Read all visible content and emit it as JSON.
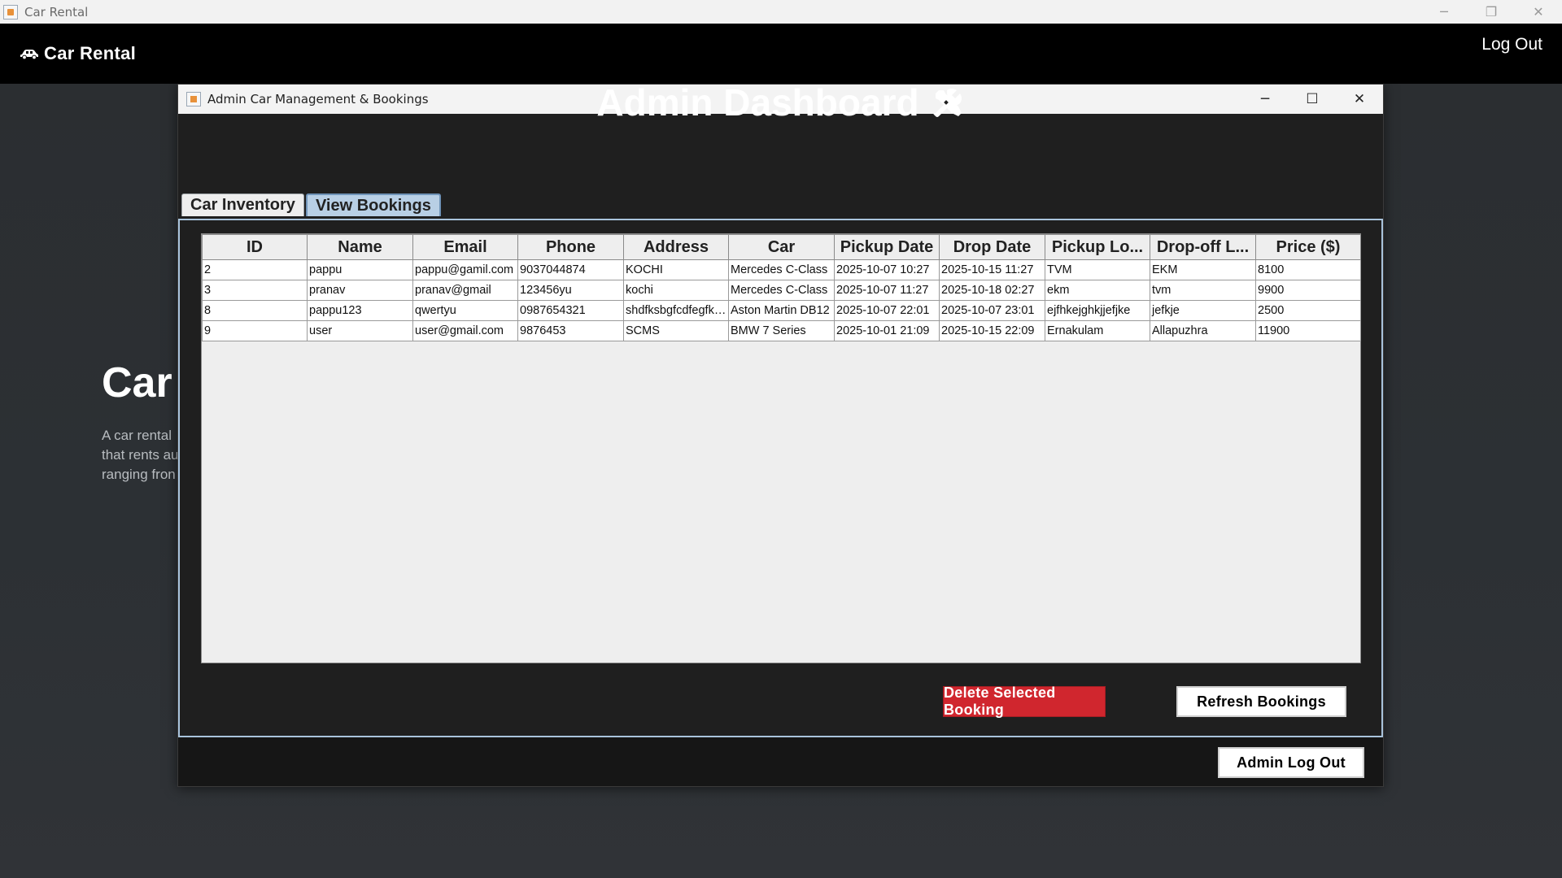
{
  "os_window": {
    "title": "Car Rental",
    "controls": [
      "─",
      "❐",
      "✕"
    ]
  },
  "header": {
    "brand": "Car Rental",
    "logout": "Log Out"
  },
  "hero": {
    "title": "Car",
    "desc_lines": [
      "A car rental",
      "that rents au",
      "ranging fron"
    ]
  },
  "dialog": {
    "title": "Admin Car Management & Bookings",
    "controls": [
      "─",
      "☐",
      "✕"
    ],
    "heading": "Admin Dashboard",
    "tabs": [
      "Car Inventory",
      "View Bookings"
    ],
    "active_tab": "View Bookings",
    "table": {
      "columns": [
        "ID",
        "Name",
        "Email",
        "Phone",
        "Address",
        "Car",
        "Pickup Date",
        "Drop Date",
        "Pickup Lo...",
        "Drop-off L...",
        "Price ($)"
      ],
      "rows": [
        [
          "2",
          "pappu",
          "pappu@gamil.com",
          "9037044874",
          "KOCHI",
          "Mercedes C-Class",
          "2025-10-07 10:27",
          "2025-10-15 11:27",
          "TVM",
          "EKM",
          "8100"
        ],
        [
          "3",
          "pranav",
          "pranav@gmail",
          "123456yu",
          "kochi",
          "Mercedes C-Class",
          "2025-10-07 11:27",
          "2025-10-18 02:27",
          "ekm",
          "tvm",
          "9900"
        ],
        [
          "8",
          "pappu123",
          "qwertyu",
          "0987654321",
          "shdfksbgfcdfegfku...",
          "Aston Martin DB12",
          "2025-10-07 22:01",
          "2025-10-07 23:01",
          "ejfhkejghkjjefjke",
          "jefkje",
          "2500"
        ],
        [
          "9",
          "user",
          "user@gmail.com",
          "9876453",
          "SCMS",
          "BMW 7 Series",
          "2025-10-01 21:09",
          "2025-10-15 22:09",
          "Ernakulam",
          "Allapuzhra",
          "11900"
        ]
      ]
    },
    "buttons": {
      "delete": "Delete Selected Booking",
      "refresh": "Refresh Bookings",
      "admin_logout": "Admin Log Out"
    }
  },
  "colors": {
    "delete_button": "#d0262e",
    "active_tab": "#b8cfe5",
    "header_bg": "#000000",
    "dialog_bg": "#1f1f1f"
  }
}
